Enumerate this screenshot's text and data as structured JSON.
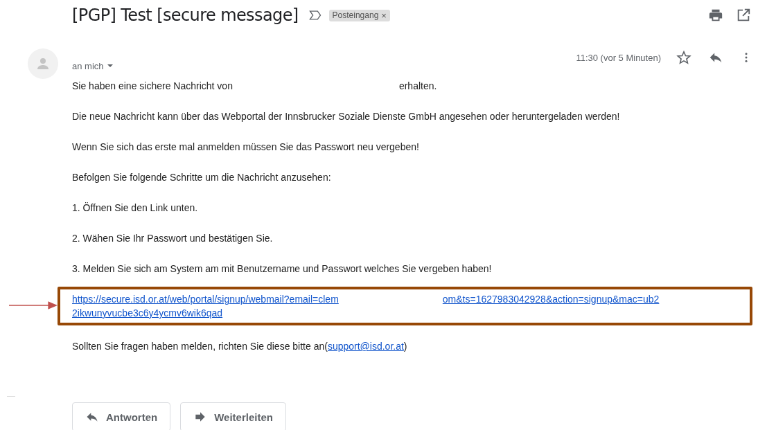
{
  "subject": "[PGP] Test [secure message]",
  "label": {
    "text": "Posteingang",
    "close": "×"
  },
  "message": {
    "recipient": "an mich",
    "time": "11:30 (vor 5 Minuten)",
    "starred": false,
    "intro": [
      "Sie haben eine sichere Nachricht von",
      "erhalten."
    ],
    "paragraphs": [
      "Die neue Nachricht kann über das Webportal der Innsbrucker Soziale Dienste GmbH angesehen oder heruntergeladen werden!",
      "Wenn Sie sich das erste mal anmelden müssen Sie das Passwort neu vergeben!",
      "Befolgen Sie folgende Schritte um die Nachricht anzusehen:",
      "1. Öffnen Sie den Link unten.",
      "2. Wähen Sie Ihr Passwort und bestätigen Sie.",
      "3. Melden Sie sich am System am mit Benutzername und Passwort welches Sie vergeben haben!"
    ],
    "link_parts": [
      "https://secure.isd.or.at/web/portal/signup/webmail?email=clem",
      "om&ts=1627983042928&action=signup&mac=ub2",
      "2ikwunyvucbe3c6y4ycmv6wik6qad"
    ],
    "contact": {
      "text": "Sollten Sie fragen haben melden, richten Sie diese bitte an(",
      "email": "support@isd.or.at",
      "end": ")"
    }
  },
  "buttons": [
    {
      "kind": "reply",
      "label": "Antworten"
    },
    {
      "kind": "forward",
      "label": "Weiterleiten"
    }
  ]
}
